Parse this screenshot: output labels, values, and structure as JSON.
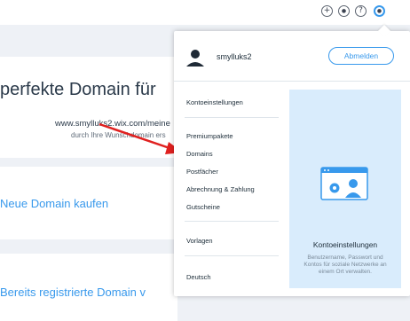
{
  "topbar": {
    "icons": [
      {
        "name": "plus-icon",
        "glyph": "+"
      },
      {
        "name": "bell-icon",
        "glyph": "●"
      },
      {
        "name": "help-icon",
        "glyph": "?"
      },
      {
        "name": "user-icon",
        "glyph": "●"
      }
    ]
  },
  "main": {
    "hero_title": "perfekte Domain für",
    "hero_url": "www.smylluks2.wix.com/meine",
    "hero_subtitle": "durch Ihre Wunschdomain ers",
    "card_buy_title": "Neue Domain kaufen",
    "card_connect_title": "Bereits registrierte Domain v"
  },
  "dropdown": {
    "username": "smylluks2",
    "logout_label": "Abmelden",
    "items": [
      "Kontoeinstellungen",
      "Premiumpakete",
      "Domains",
      "Postfächer",
      "Abrechnung & Zahlung",
      "Gutscheine",
      "Vorlagen",
      "Deutsch"
    ],
    "panel": {
      "title": "Kontoeinstellungen",
      "description": "Benutzername, Passwort und Kontos für soziale Netzwerke an einem Ort verwalten."
    }
  },
  "colors": {
    "accent": "#3899ec",
    "arrow": "#e0201f",
    "panel_bg": "#d9ecfc",
    "page_bg": "#eef1f6"
  }
}
